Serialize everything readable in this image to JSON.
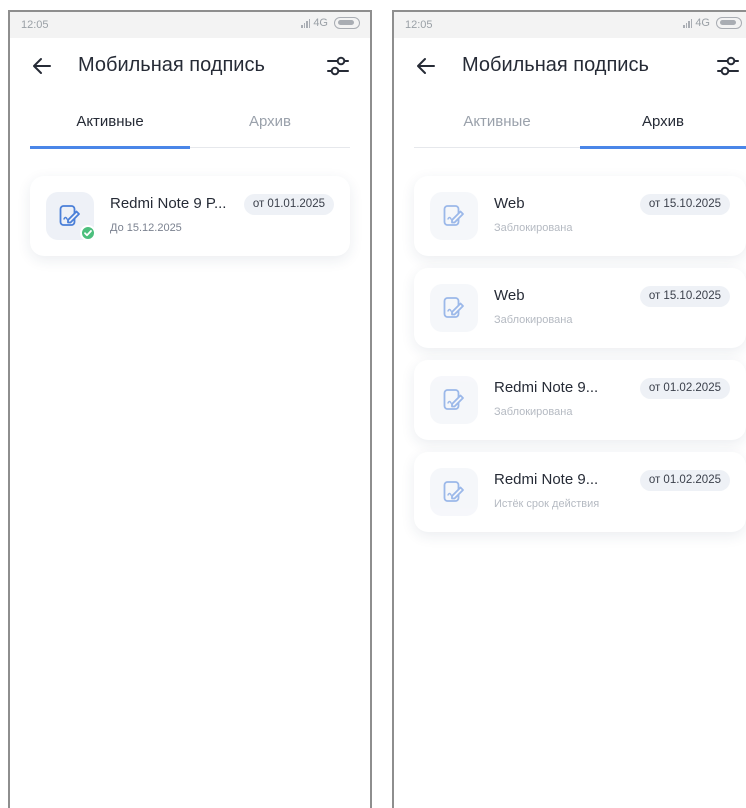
{
  "screens": [
    {
      "status_time": "12:05",
      "status_network": "4G",
      "title": "Мобильная подпись",
      "tabs": [
        {
          "label": "Активные",
          "active": true
        },
        {
          "label": "Архив",
          "active": false
        }
      ],
      "cards": [
        {
          "title": "Redmi Note 9 P...",
          "subtitle": "До 15.12.2025",
          "date": "от 01.01.2025",
          "status": "active"
        }
      ]
    },
    {
      "status_time": "12:05",
      "status_network": "4G",
      "title": "Мобильная подпись",
      "tabs": [
        {
          "label": "Активные",
          "active": false
        },
        {
          "label": "Архив",
          "active": true
        }
      ],
      "cards": [
        {
          "title": "Web",
          "subtitle": "Заблокирована",
          "date": "от 15.10.2025",
          "status": "archived"
        },
        {
          "title": "Web",
          "subtitle": "Заблокирована",
          "date": "от 15.10.2025",
          "status": "archived"
        },
        {
          "title": "Redmi Note 9...",
          "subtitle": "Заблокирована",
          "date": "от 01.02.2025",
          "status": "archived"
        },
        {
          "title": "Redmi Note 9...",
          "subtitle": "Истёк срок действия",
          "date": "от 01.02.2025",
          "status": "archived"
        }
      ]
    }
  ],
  "icons": {
    "back": "arrow-left-icon",
    "filter": "sliders-icon",
    "document": "signature-document-icon",
    "check": "check-icon"
  },
  "colors": {
    "accent": "#4a86e8",
    "success": "#4cbf7d",
    "badge_bg": "#eef1f6"
  }
}
